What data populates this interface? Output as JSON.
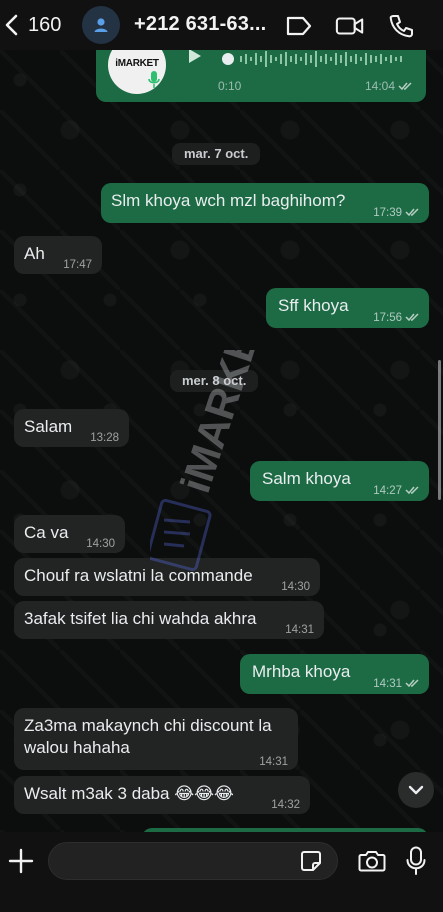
{
  "header": {
    "back_count": "160",
    "contact_name": "+212 631-63...",
    "icons": [
      "chevron-left-icon",
      "person-icon",
      "label-icon",
      "video-icon",
      "phone-icon"
    ]
  },
  "voice_message": {
    "thumbnail_text": "iMARKET",
    "duration": "0:10",
    "time": "14:04"
  },
  "dates": {
    "date1": "mar. 7 oct.",
    "date2": "mer. 8 oct."
  },
  "messages": [
    {
      "dir": "out",
      "text": "Slm khoya wch mzl baghihom?",
      "time": "17:39"
    },
    {
      "dir": "in",
      "text": "Ah",
      "time": "17:47"
    },
    {
      "dir": "out",
      "text": "Sff khoya",
      "time": "17:56"
    },
    {
      "dir": "in",
      "text": "Salam",
      "time": "13:28"
    },
    {
      "dir": "out",
      "text": "Salm khoya",
      "time": "14:27"
    },
    {
      "dir": "in",
      "text": "Ca va",
      "time": "14:30"
    },
    {
      "dir": "in",
      "text": "Chouf ra wslatni la commande",
      "time": "14:30"
    },
    {
      "dir": "in",
      "text": "3afak tsifet lia chi wahda akhra",
      "time": "14:31"
    },
    {
      "dir": "out",
      "text": "Mrhba khoya",
      "time": "14:31"
    },
    {
      "dir": "in",
      "text": "Za3ma makaynch chi discount la walou hahaha",
      "time": "14:31"
    },
    {
      "dir": "in",
      "text": "Wsalt m3ak 3 daba 😂😂😂",
      "time": "14:32"
    }
  ],
  "watermark": {
    "text": "iMARKET"
  },
  "composer": {
    "value": "",
    "placeholder": ""
  },
  "colors": {
    "outgoing": "#1c6b45",
    "incoming": "#222424",
    "background": "#0c0d0d",
    "header": "#111111"
  }
}
